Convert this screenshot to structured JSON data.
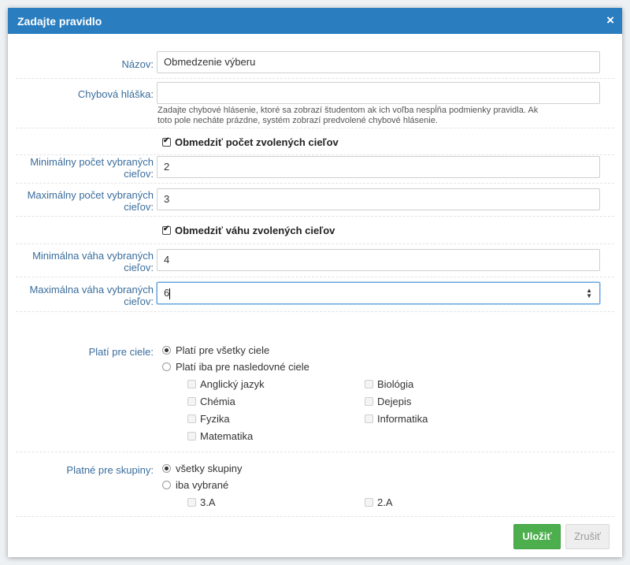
{
  "dialog": {
    "title": "Zadajte pravidlo",
    "close_icon": "×"
  },
  "form": {
    "name_label": "Názov:",
    "name_value": "Obmedzenie výberu",
    "error_label": "Chybová hláška:",
    "error_value": "",
    "error_help_line1": "Zadajte chybové hlásenie, ktoré sa zobrazí študentom ak ich voľba nespĺňa podmienky pravidla. Ak",
    "error_help_line2": "toto pole necháte prázdne, systém zobrazí predvolené chybové hlásenie.",
    "limit_count_label": "Obmedziť počet zvolených cieľov",
    "limit_count_checked": true,
    "min_count_label_1": "Minimálny počet vybraných",
    "min_count_label_2": "cieľov:",
    "min_count_value": "2",
    "max_count_label_1": "Maximálny počet vybraných",
    "max_count_label_2": "cieľov:",
    "max_count_value": "3",
    "limit_weight_label": "Obmedziť váhu zvolených cieľov",
    "limit_weight_checked": true,
    "min_weight_label_1": "Minimálna váha vybraných",
    "min_weight_label_2": "cieľov:",
    "min_weight_value": "4",
    "max_weight_label_1": "Maximálna váha vybraných",
    "max_weight_label_2": "cieľov:",
    "max_weight_value": "6",
    "spinner_icon": "▲▼"
  },
  "goals": {
    "label": "Platí pre ciele:",
    "option_all": "Platí pre všetky ciele",
    "option_selected": "Platí iba pre nasledovné ciele",
    "selected_option": "all",
    "items": [
      "Anglický jazyk",
      "Biológia",
      "Chémia",
      "Dejepis",
      "Fyzika",
      "Informatika",
      "Matematika"
    ]
  },
  "groups": {
    "label": "Platné pre skupiny:",
    "option_all": "všetky skupiny",
    "option_selected": "iba vybrané",
    "selected_option": "all",
    "items": [
      "3.A",
      "2.A"
    ]
  },
  "buttons": {
    "save": "Uložiť",
    "cancel": "Zrušiť"
  },
  "colors": {
    "titlebar": "#2a7dbf",
    "label": "#3a6d9c",
    "save": "#4cae4c"
  }
}
